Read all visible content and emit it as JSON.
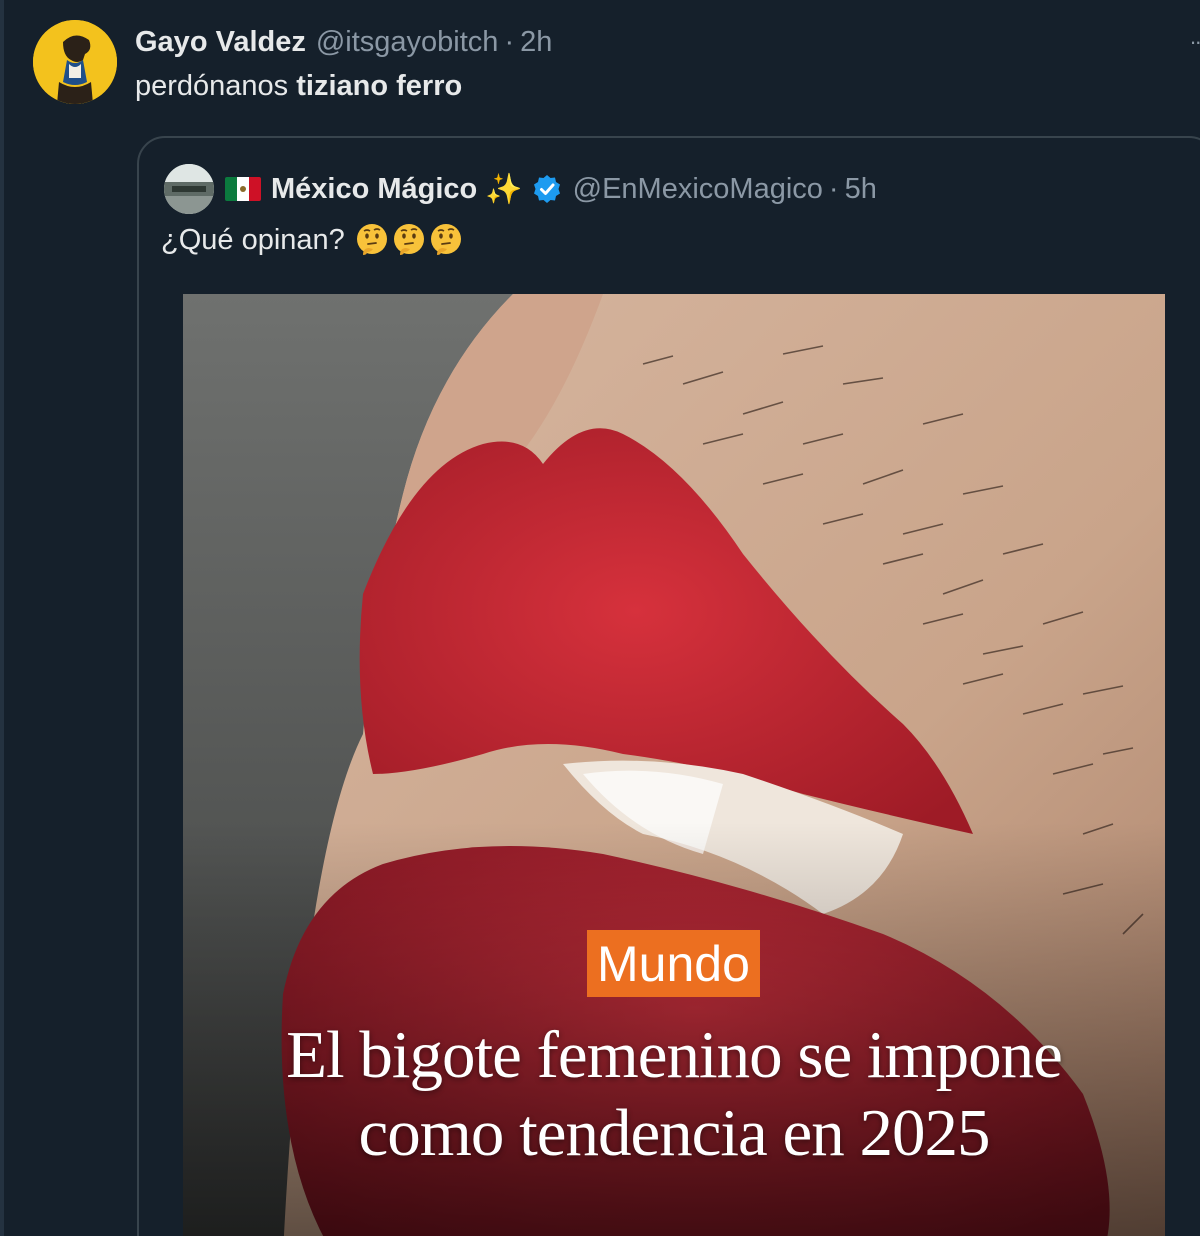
{
  "tweet": {
    "author_name": "Gayo Valdez",
    "author_handle": "@itsgayobitch",
    "separator": "·",
    "time": "2h",
    "more_label": "··",
    "text_plain": "perdónanos ",
    "text_bold": "tiziano ferro"
  },
  "quoted_tweet": {
    "flag_icon": "mexico-flag-icon",
    "author_name": "México Mágico",
    "sparkle": "✨",
    "verified_icon": "verified-badge-icon",
    "author_handle": "@EnMexicoMagico",
    "separator": "·",
    "time": "5h",
    "text": "¿Qué opinan?",
    "emojis": [
      "thinking-face-icon",
      "thinking-face-icon",
      "thinking-face-icon"
    ]
  },
  "media": {
    "section_badge": "Mundo",
    "headline_line1": "El bigote femenino se impone",
    "headline_line2": "como tendencia en 2025"
  },
  "colors": {
    "background": "#15202b",
    "border": "#38444d",
    "muted_text": "#8b98a5",
    "primary_text": "#e7e9ea",
    "badge": "#ec6f20",
    "verified": "#1d9bf0"
  }
}
